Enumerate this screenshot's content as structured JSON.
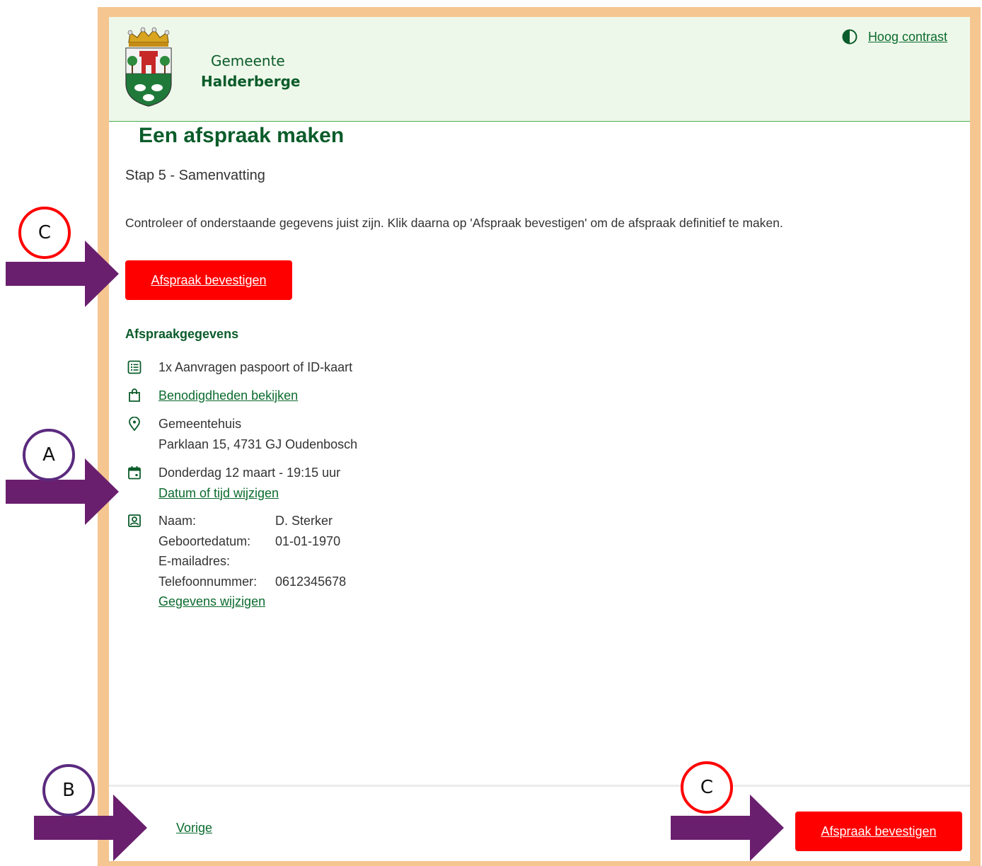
{
  "header": {
    "brand_line1": "Gemeente",
    "brand_line2": "Halderberge",
    "contrast_label": "Hoog contrast"
  },
  "main": {
    "title": "Een afspraak maken",
    "step": "Stap 5 - Samenvatting",
    "intro": "Controleer of onderstaande gegevens juist zijn. Klik daarna op 'Afspraak bevestigen' om de afspraak definitief te maken.",
    "confirm_label": "Afspraak bevestigen",
    "section_title": "Afspraakgegevens",
    "product": "1x Aanvragen paspoort of ID-kaart",
    "requirements_link": "Benodigdheden bekijken",
    "location_name": "Gemeentehuis",
    "location_address": "Parklaan 15, 4731 GJ Oudenbosch",
    "datetime": "Donderdag 12 maart - 19:15 uur",
    "change_datetime_link": "Datum of tijd wijzigen",
    "person": [
      {
        "label": "Naam:",
        "value": "D. Sterker"
      },
      {
        "label": "Geboortedatum:",
        "value": "01-01-1970"
      },
      {
        "label": "E-mailadres:",
        "value": ""
      },
      {
        "label": "Telefoonnummer:",
        "value": "0612345678"
      }
    ],
    "change_details_link": "Gegevens wijzigen"
  },
  "footer": {
    "previous_label": "Vorige",
    "confirm_label": "Afspraak bevestigen"
  },
  "annotations": {
    "markers": [
      "C",
      "A",
      "B",
      "C"
    ]
  },
  "colors": {
    "accent_green": "#0b5c2a",
    "link_green": "#0b6b2e",
    "button_red": "#ff0000",
    "frame_orange": "#f5c690",
    "header_bg": "#eef8ea",
    "marker_red": "#ff0000",
    "marker_purple": "#5b2a7e",
    "arrow_purple": "#6a1f6e"
  },
  "icons": [
    "coat-of-arms-logo",
    "contrast-icon",
    "list-icon",
    "shopping-bag-icon",
    "location-pin-icon",
    "calendar-icon",
    "contact-card-icon"
  ]
}
